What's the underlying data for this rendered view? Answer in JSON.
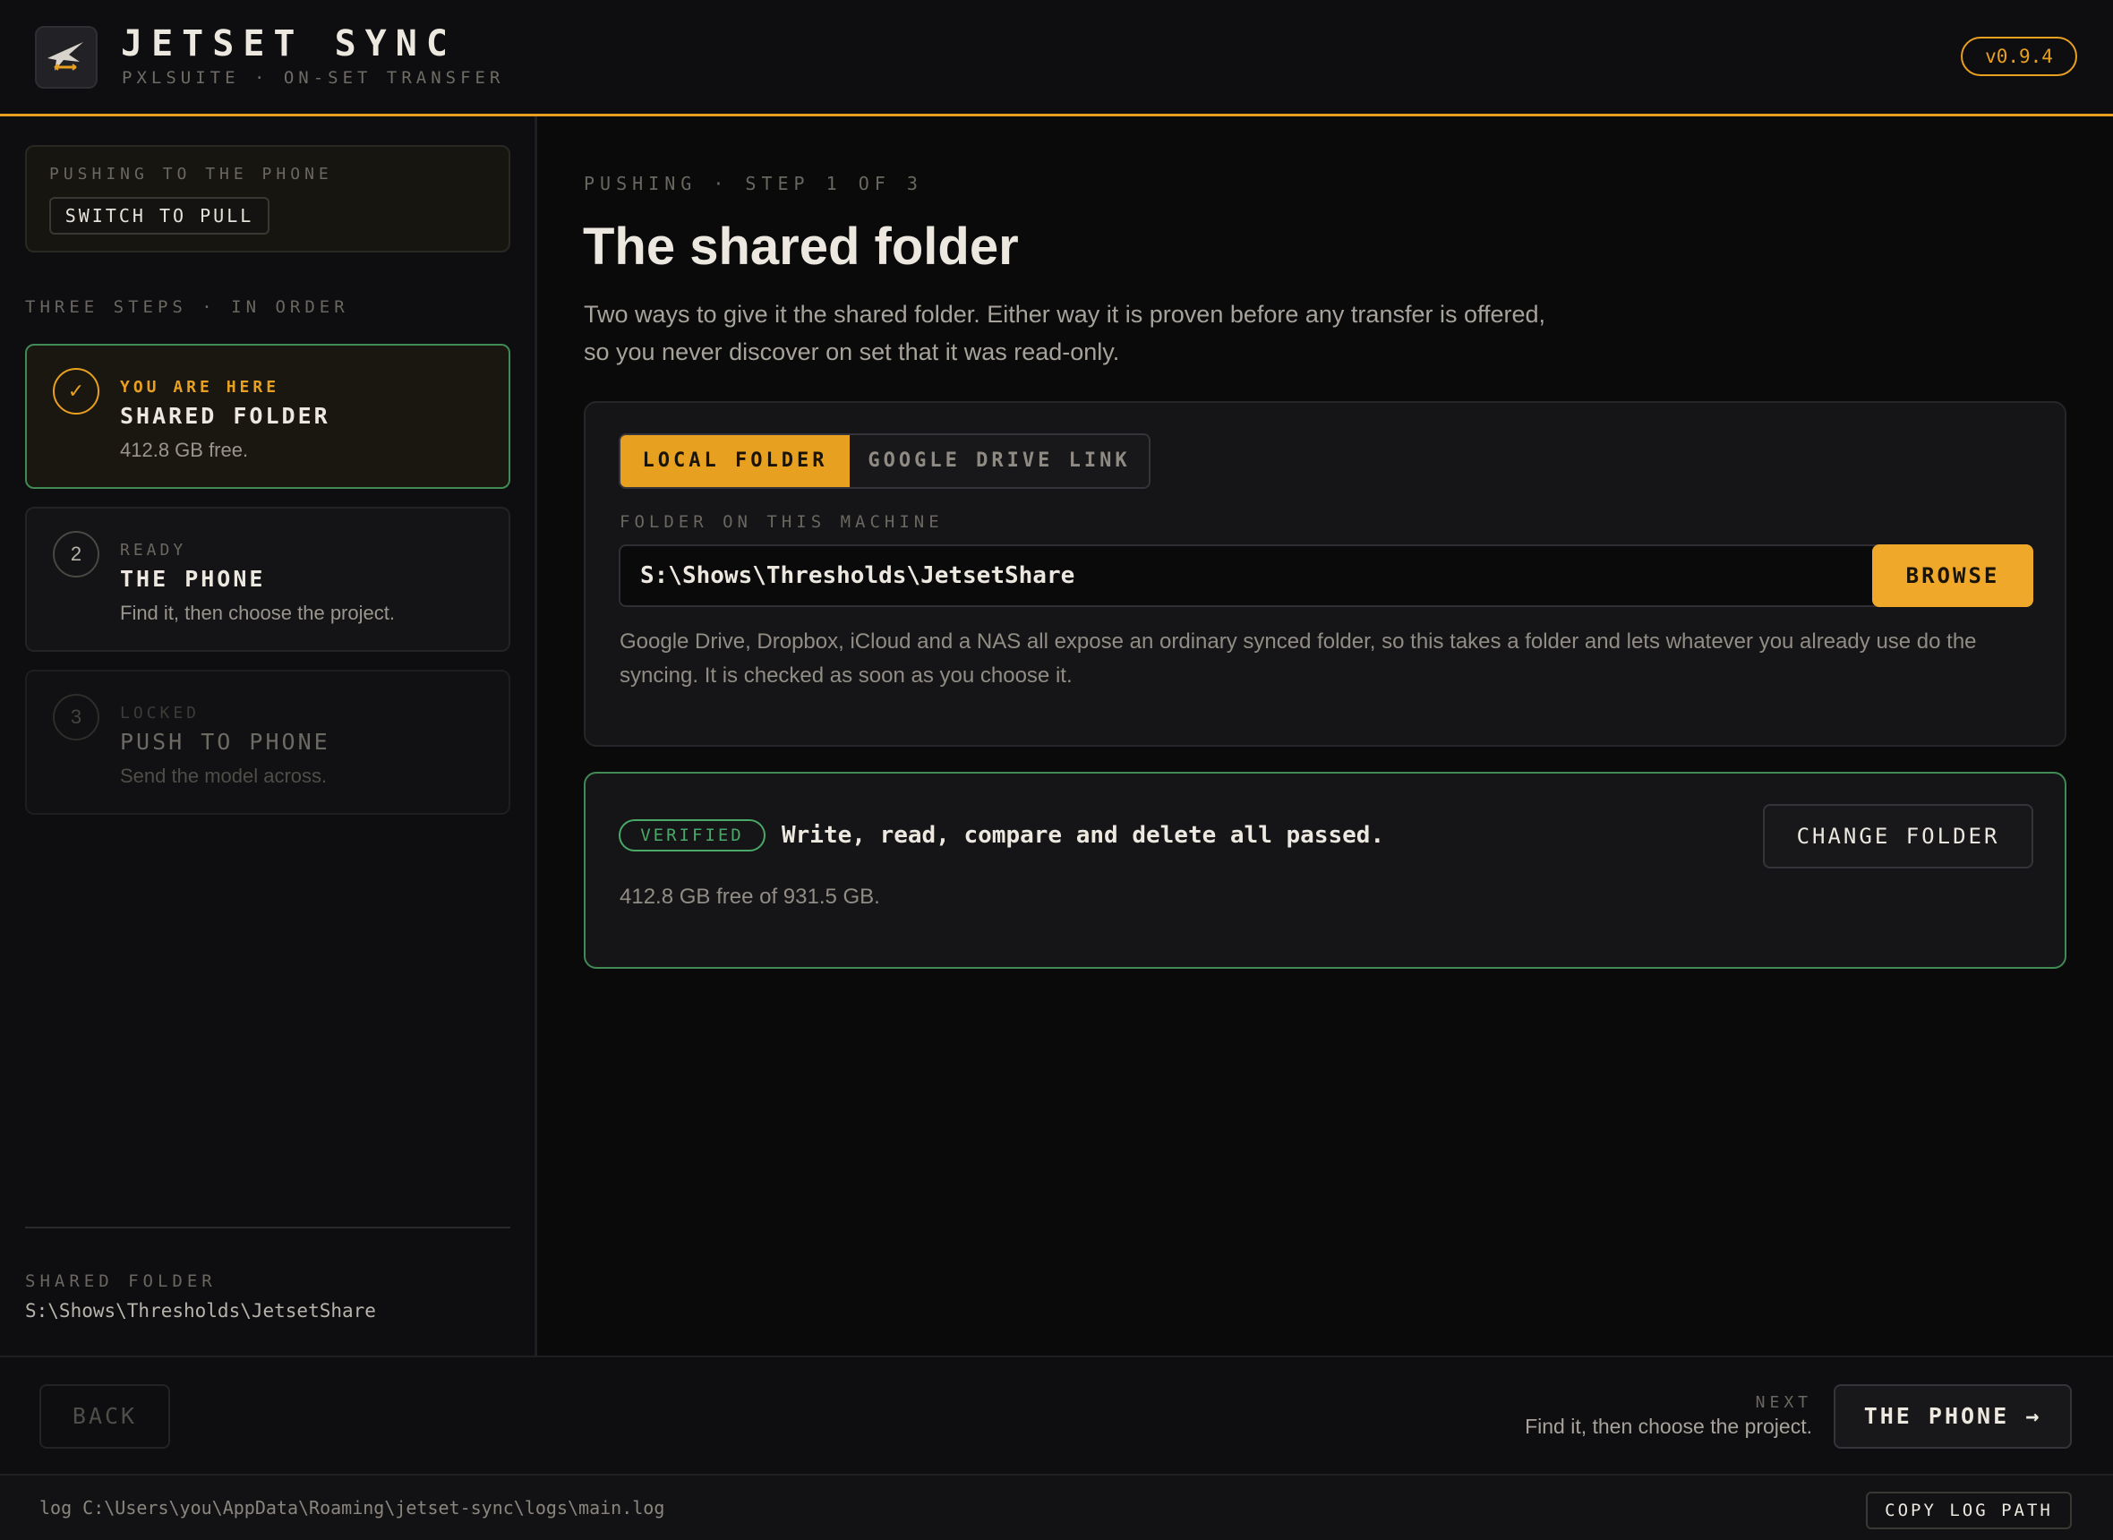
{
  "app": {
    "title": "JETSET SYNC",
    "subtitle": "PXLSUITE · ON-SET TRANSFER",
    "version": "v0.9.4",
    "accent_color": "#e8a020",
    "success_color": "#4aa869",
    "logo_icon": "jet-plane-icon"
  },
  "sidebar": {
    "mode_label": "PUSHING TO THE PHONE",
    "switch_label": "SWITCH TO PULL",
    "steps_heading": "THREE STEPS · IN ORDER",
    "steps": [
      {
        "marker": "✓",
        "status": "YOU ARE HERE",
        "title": "SHARED FOLDER",
        "desc": "412.8 GB free.",
        "state": "current"
      },
      {
        "marker": "2",
        "status": "READY",
        "title": "THE PHONE",
        "desc": "Find it, then choose the project.",
        "state": "ready"
      },
      {
        "marker": "3",
        "status": "LOCKED",
        "title": "PUSH TO PHONE",
        "desc": "Send the model across.",
        "state": "locked"
      }
    ],
    "folder_label": "SHARED FOLDER",
    "folder_path": "S:\\Shows\\Thresholds\\JetsetShare"
  },
  "main": {
    "eyebrow": "PUSHING · STEP 1 OF 3",
    "title": "The shared folder",
    "intro": "Two ways to give it the shared folder. Either way it is proven before any transfer is offered, so you never discover on set that it was read-only.",
    "tabs": [
      {
        "label": "LOCAL FOLDER",
        "active": true
      },
      {
        "label": "GOOGLE DRIVE LINK",
        "active": false
      }
    ],
    "folder_field_label": "FOLDER ON THIS MACHINE",
    "folder_value": "S:\\Shows\\Thresholds\\JetsetShare",
    "browse_label": "BROWSE",
    "note": "Google Drive, Dropbox, iCloud and a NAS all expose an ordinary synced folder, so this takes a folder and lets whatever you already use do the syncing. It is checked as soon as you choose it.",
    "verify": {
      "badge": "VERIFIED",
      "message": "Write, read, compare and delete all passed.",
      "free": "412.8 GB free of 931.5 GB.",
      "change_label": "CHANGE FOLDER"
    }
  },
  "footer": {
    "back_label": "BACK",
    "next_label": "NEXT",
    "next_desc": "Find it, then choose the project.",
    "next_button": "THE PHONE →"
  },
  "logbar": {
    "log_text": "log C:\\Users\\you\\AppData\\Roaming\\jetset-sync\\logs\\main.log",
    "copy_label": "COPY LOG PATH"
  }
}
